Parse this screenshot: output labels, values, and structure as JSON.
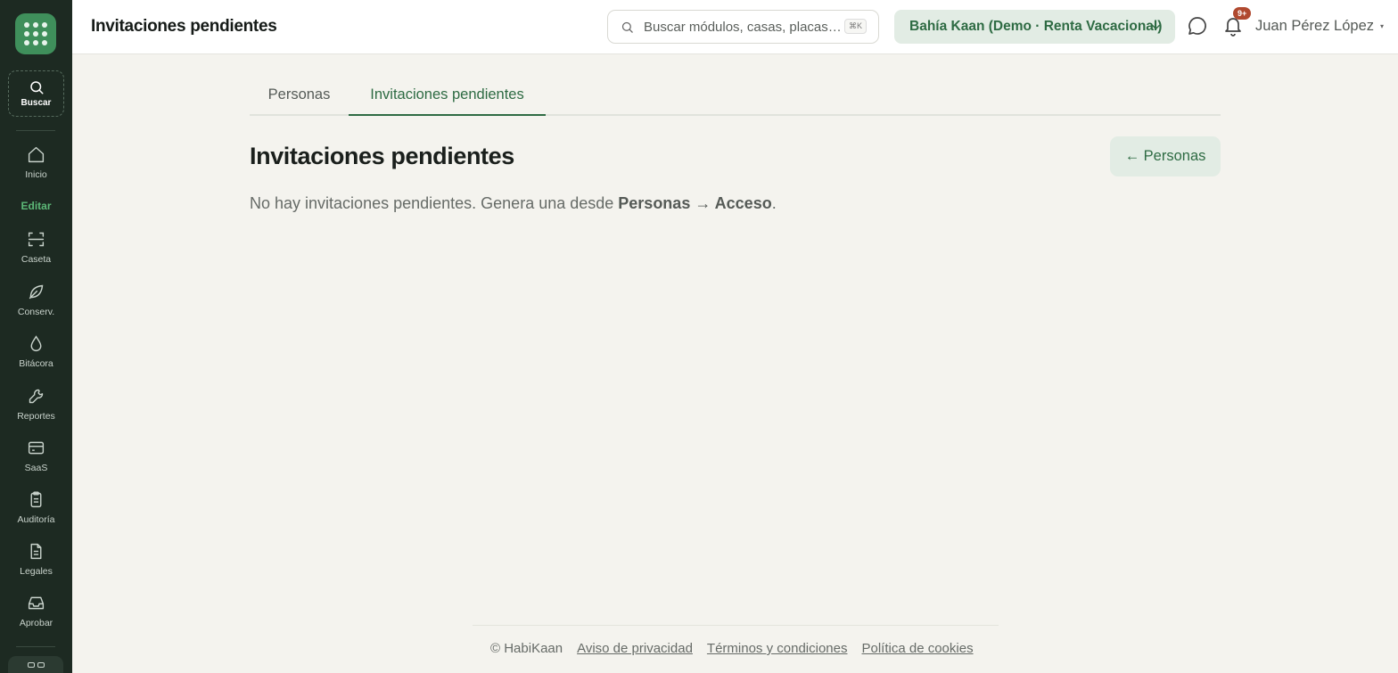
{
  "header": {
    "title": "Invitaciones pendientes",
    "search_placeholder": "Buscar módulos, casas, placas…",
    "search_shortcut": "⌘K",
    "org_selector": "Bahía Kaan (Demo · Renta Vacacional)",
    "notification_badge": "9+",
    "user_name": "Juan Pérez López",
    "user_caret": "▾"
  },
  "sidebar": {
    "search_label": "Buscar",
    "home_label": "Inicio",
    "edit_label": "Editar",
    "items": [
      {
        "label": "Caseta",
        "icon": "scan-icon"
      },
      {
        "label": "Conserv.",
        "icon": "leaf-icon"
      },
      {
        "label": "Bitácora",
        "icon": "droplet-icon"
      },
      {
        "label": "Reportes",
        "icon": "wrench-icon"
      },
      {
        "label": "SaaS",
        "icon": "credit-card-icon"
      },
      {
        "label": "Auditoría",
        "icon": "clipboard-icon"
      },
      {
        "label": "Legales",
        "icon": "document-icon"
      },
      {
        "label": "Aprobar",
        "icon": "inbox-icon"
      }
    ]
  },
  "tabs": [
    {
      "label": "Personas",
      "active": false
    },
    {
      "label": "Invitaciones pendientes",
      "active": true
    }
  ],
  "main": {
    "title": "Invitaciones pendientes",
    "back_button": "← Personas",
    "empty_prefix": "No hay invitaciones pendientes. Genera una desde ",
    "empty_link": "Personas → Acceso",
    "empty_suffix": "."
  },
  "footer": {
    "copyright": "© HabiKaan",
    "privacy": "Aviso de privacidad",
    "terms": "Términos y condiciones",
    "cookies": "Política de cookies"
  },
  "colors": {
    "sidebar_bg": "#1d2a22",
    "brand_green": "#3f8f5b",
    "accent_text": "#2e6b43",
    "badge": "#b0492f",
    "page_bg": "#f4f3ee"
  }
}
